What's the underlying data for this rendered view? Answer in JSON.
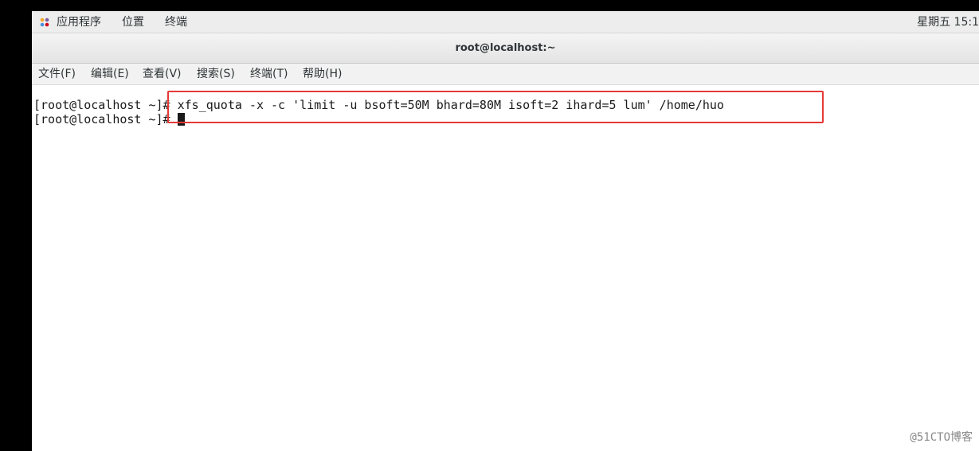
{
  "top_panel": {
    "apps_icon": "gnome-foot-icon",
    "items": [
      {
        "label": "应用程序"
      },
      {
        "label": "位置"
      },
      {
        "label": "终端"
      }
    ],
    "clock": "星期五 15:1"
  },
  "window": {
    "title": "root@localhost:~"
  },
  "menubar": {
    "items": [
      {
        "label": "文件(F)"
      },
      {
        "label": "编辑(E)"
      },
      {
        "label": "查看(V)"
      },
      {
        "label": "搜索(S)"
      },
      {
        "label": "终端(T)"
      },
      {
        "label": "帮助(H)"
      }
    ]
  },
  "terminal": {
    "lines": [
      {
        "prompt": "[root@localhost ~]#",
        "command": " xfs_quota -x -c 'limit -u bsoft=50M bhard=80M isoft=2 ihard=5 lum' /home/huo"
      },
      {
        "prompt": "[root@localhost ~]#",
        "command": " "
      }
    ]
  },
  "annotation": {
    "highlight_color": "#e53935"
  },
  "watermark": "@51CTO博客"
}
